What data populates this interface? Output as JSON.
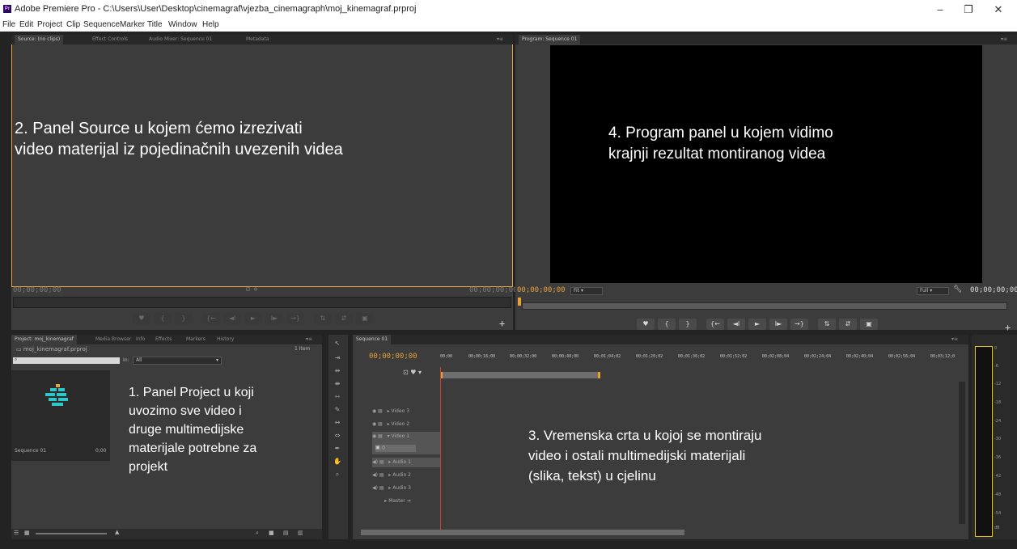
{
  "window": {
    "app_icon": "Pr",
    "title": "Adobe Premiere Pro - C:\\Users\\User\\Desktop\\cinemagraf\\vjezba_cinemagraph\\moj_kinemagraf.prproj",
    "minimize": "–",
    "restore": "❐",
    "close": "✕"
  },
  "menu": [
    "File",
    "Edit",
    "Project",
    "Clip",
    "Sequence",
    "Marker",
    "Title",
    "Window",
    "Help"
  ],
  "source_panel": {
    "tabs": [
      "Source: (no clips)",
      "Effect Controls",
      "Audio Mixer: Sequence 01",
      "Metadata"
    ],
    "timecode_in": "00;00;00;00",
    "timecode_out": "00;00;00;00",
    "annotation_line1": "2. Panel Source u kojem ćemo izrezivati",
    "annotation_line2": "video materijal iz pojedinačnih uvezenih videa",
    "controls": [
      "♥",
      "{",
      "}",
      "{←",
      "◄I",
      "►",
      "I►",
      "→}",
      "⇅",
      "⇵",
      "▣"
    ],
    "add_icon": "+"
  },
  "program_panel": {
    "tab": "Program: Sequence 01",
    "timecode": "00;00;00;00",
    "timecode_right": "00;00;00;00",
    "fit": "Fit",
    "full": "Full",
    "annotation_line1": "4. Program panel u kojem vidimo",
    "annotation_line2": "krajnji rezultat montiranog videa",
    "controls": [
      "♥",
      "{",
      "}",
      "{←",
      "◄I",
      "►",
      "I►",
      "→}",
      "⇅",
      "⇵",
      "▣"
    ],
    "add_icon": "+"
  },
  "project_panel": {
    "tabs": [
      "Project: moj_kinemagraf",
      "Media Browser",
      "Info",
      "Effects",
      "Markers",
      "History"
    ],
    "file": "moj_kinemagraf.prproj",
    "item_count": "1 Item",
    "in_label": "In:",
    "in_value": "All",
    "clip_name": "Sequence 01",
    "clip_duration": "0;00",
    "annotation": [
      "1. Panel Project u koji",
      "uvozimo sve  video i",
      "druge multimedijske",
      "materijale potrebne za",
      "projekt"
    ]
  },
  "timeline": {
    "tab": "Sequence 01",
    "timecode": "00;00;00;00",
    "ruler": [
      "00;00",
      "00;00;16;00",
      "00;00;32;00",
      "00;00;48;00",
      "00;01;04;02",
      "00;01;20;02",
      "00;01;36;02",
      "00;01;52;02",
      "00;02;08;04",
      "00;02;24;04",
      "00;02;40;04",
      "00;02;56;04",
      "00;03;12;0"
    ],
    "tracks": [
      "Video 3",
      "Video 2",
      "Video 1",
      "Audio 1",
      "Audio 2",
      "Audio 3",
      "Master"
    ],
    "annotation_line1": "3. Vremenska crta u kojoj se montiraju",
    "annotation_line2": "video i ostali multimedijski materijali",
    "annotation_line3": "(slika, tekst) u cjelinu"
  },
  "meter_ticks": [
    "0",
    "-6",
    "-12",
    "-18",
    "-24",
    "-30",
    "-36",
    "-42",
    "-48",
    "-54",
    "dB"
  ],
  "colors": {
    "accent_orange": "#e8a13a",
    "panel_bg": "#3c3c3c",
    "dark_bg": "#232323",
    "playhead_red": "#d63b2b"
  }
}
